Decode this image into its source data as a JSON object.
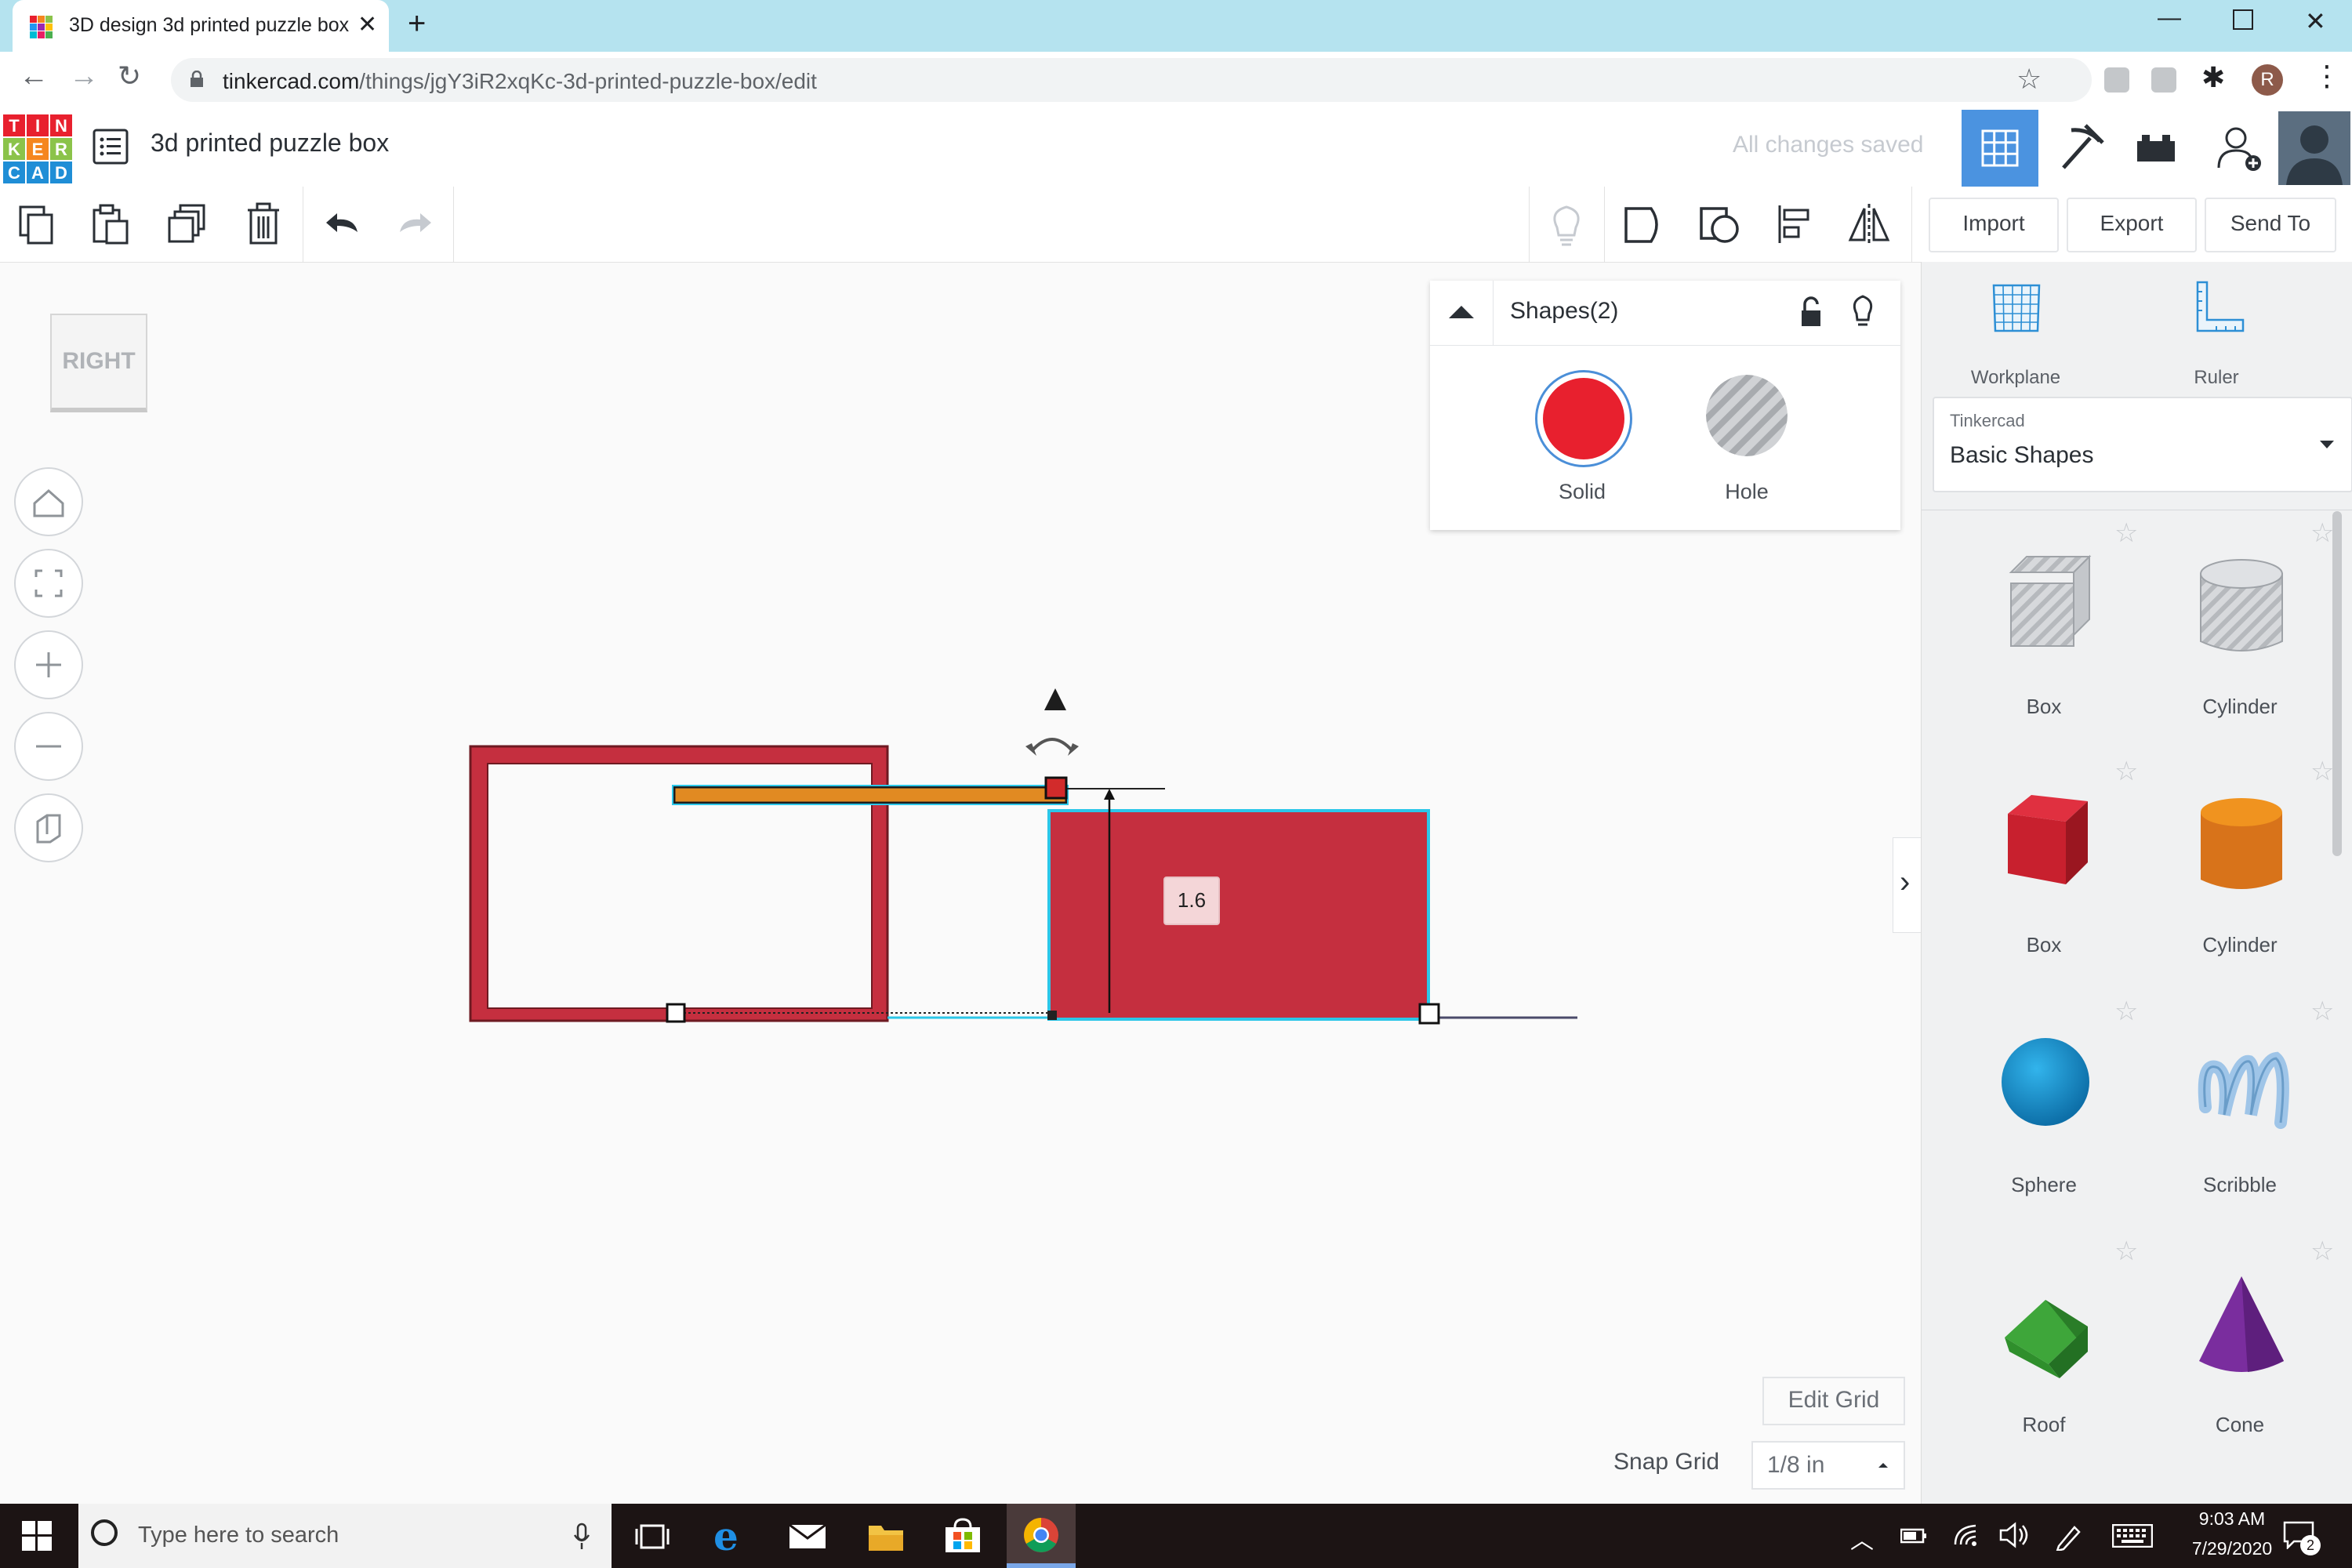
{
  "browser": {
    "tab_title": "3D design 3d printed puzzle box",
    "url_domain": "tinkercad.com",
    "url_path": "/things/jgY3iR2xqKc-3d-printed-puzzle-box/edit",
    "profile_initial": "R"
  },
  "app": {
    "logo_letters": [
      "T",
      "I",
      "N",
      "K",
      "E",
      "R",
      "C",
      "A",
      "D"
    ],
    "design_title": "3d printed puzzle box",
    "status": "All changes saved"
  },
  "toolbar": {
    "import_label": "Import",
    "export_label": "Export",
    "sendto_label": "Send To"
  },
  "viewcube": {
    "face_label": "RIGHT"
  },
  "inspector": {
    "title": "Shapes(2)",
    "solid_label": "Solid",
    "hole_label": "Hole",
    "solid_color": "#e8202e"
  },
  "canvas": {
    "dimension_value": "1.6"
  },
  "grid": {
    "edit_grid_label": "Edit Grid",
    "snap_grid_label": "Snap Grid",
    "snap_grid_value": "1/8 in"
  },
  "panel": {
    "workplane_label": "Workplane",
    "ruler_label": "Ruler",
    "library_provider": "Tinkercad",
    "library_name": "Basic Shapes",
    "shapes": [
      {
        "name": "Box",
        "icon": "box-hole-icon"
      },
      {
        "name": "Cylinder",
        "icon": "cylinder-hole-icon"
      },
      {
        "name": "Box",
        "icon": "box-red-icon"
      },
      {
        "name": "Cylinder",
        "icon": "cylinder-orange-icon"
      },
      {
        "name": "Sphere",
        "icon": "sphere-icon"
      },
      {
        "name": "Scribble",
        "icon": "scribble-icon"
      },
      {
        "name": "Roof",
        "icon": "roof-icon"
      },
      {
        "name": "Cone",
        "icon": "cone-icon"
      }
    ]
  },
  "taskbar": {
    "search_placeholder": "Type here to search",
    "time": "9:03 AM",
    "date": "7/29/2020",
    "notification_count": "2"
  }
}
